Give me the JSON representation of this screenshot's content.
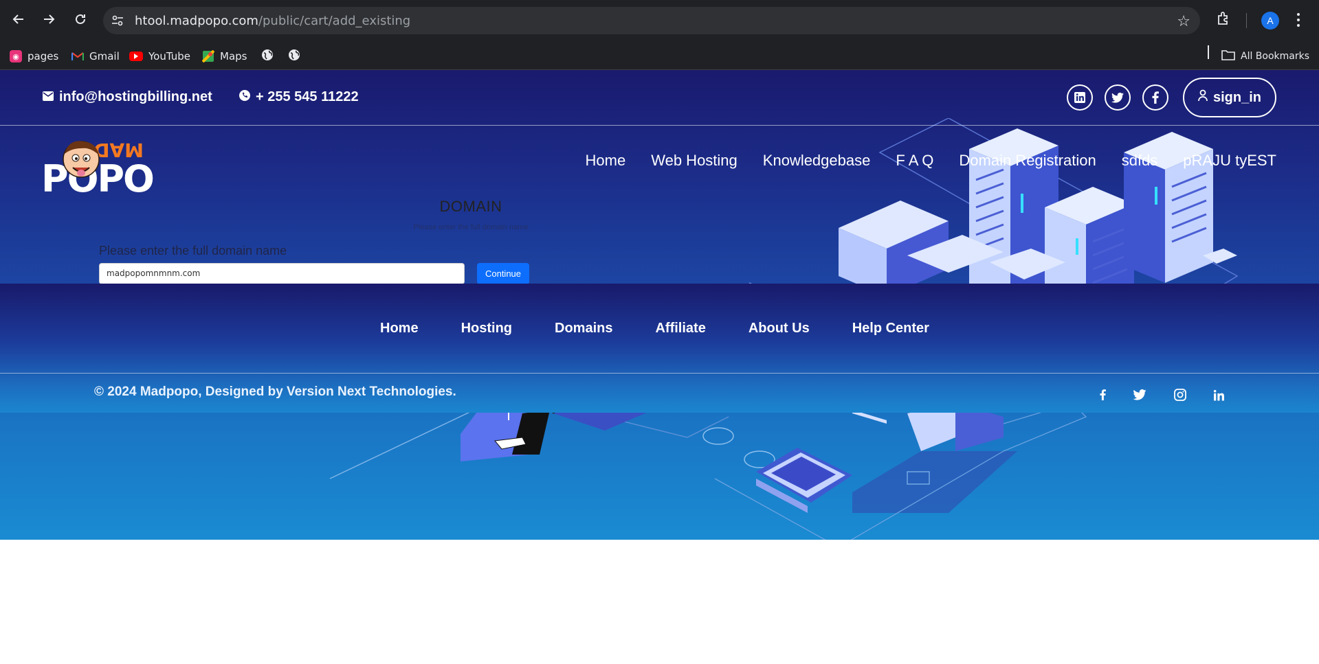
{
  "browser": {
    "url_host": "htool.madpopo.com",
    "url_path": "/public/cart/add_existing",
    "avatar_letter": "A",
    "bookmarks": [
      {
        "label": "pages",
        "icon": "pages-icon"
      },
      {
        "label": "Gmail",
        "icon": "gmail-icon"
      },
      {
        "label": "YouTube",
        "icon": "youtube-icon"
      },
      {
        "label": "Maps",
        "icon": "maps-icon"
      }
    ],
    "all_bookmarks": "All Bookmarks"
  },
  "topbar": {
    "email": "info@hostingbilling.net",
    "phone": "+ 255 545 11222",
    "social": [
      "linkedin-icon",
      "twitter-icon",
      "facebook-icon"
    ],
    "signin_label": "sign_in"
  },
  "nav": {
    "items": [
      "Home",
      "Web Hosting",
      "Knowledgebase",
      "F A Q",
      "Domain Registration",
      "sdfds",
      "pRAJU tyEST"
    ]
  },
  "domain_form": {
    "title": "DOMAIN",
    "subtitle": "Please enter the full domain name",
    "label": "Please enter the full domain name",
    "input_value": "madpopomnmnm.com",
    "button": "Continue"
  },
  "footer": {
    "links": [
      "Home",
      "Hosting",
      "Domains",
      "Affiliate",
      "About Us",
      "Help Center"
    ],
    "copyright": "© 2024 Madpopo, Designed by Version Next Technologies.",
    "social": [
      "facebook-icon",
      "twitter-icon",
      "instagram-icon",
      "linkedin-icon"
    ]
  },
  "colors": {
    "chrome_bg": "#202124",
    "hero_top": "#1a1a6e",
    "hero_bottom": "#1a8bd2",
    "button_blue": "#0d6efd",
    "logo_orange": "#f47920"
  }
}
